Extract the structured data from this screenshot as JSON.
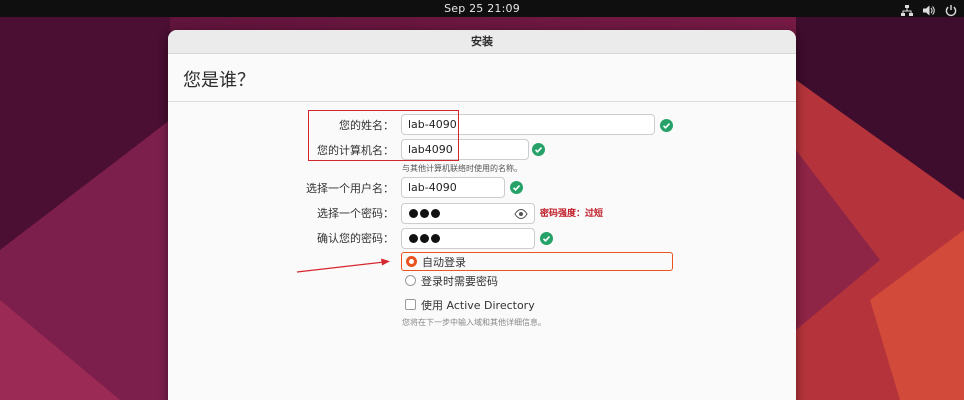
{
  "topbar": {
    "clock": "Sep 25  21:09",
    "icons": [
      "network-icon",
      "volume-icon",
      "power-icon"
    ]
  },
  "window": {
    "title": "安装",
    "heading": "您是谁？"
  },
  "form": {
    "name_label": "您的姓名：",
    "name_value": "lab-4090",
    "computer_label": "您的计算机名：",
    "computer_value": "lab4090",
    "computer_hint": "与其他计算机联络时使用的名称。",
    "username_label": "选择一个用户名：",
    "username_value": "lab-4090",
    "password_label": "选择一个密码：",
    "password_strength": "密码强度：过短",
    "confirm_label": "确认您的密码：",
    "auto_login_label": "自动登录",
    "require_password_label": "登录时需要密码",
    "active_directory_label": "使用 Active Directory",
    "active_directory_note": "您将在下一步中输入域和其他详细信息。"
  },
  "colors": {
    "accent": "#e95420",
    "ok": "#26a269",
    "annotation": "#d6262d",
    "strength": "#c01c28"
  }
}
